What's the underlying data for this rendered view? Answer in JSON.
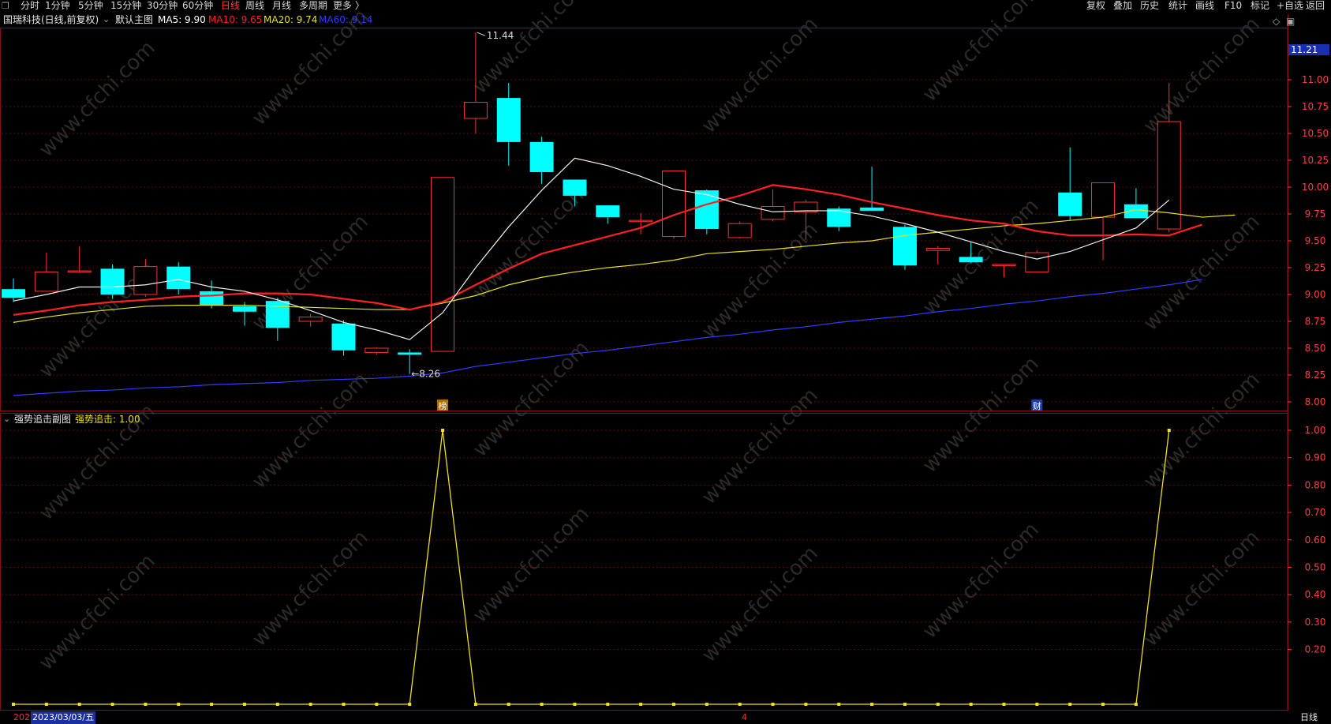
{
  "toolbar": {
    "corner_icon": "window-restore-icon",
    "left_items": [
      "分时",
      "1分钟",
      "5分钟",
      "15分钟",
      "30分钟",
      "60分钟",
      "日线",
      "周线",
      "月线",
      "多周期",
      "更多 〉"
    ],
    "active_item": "日线",
    "right_items": [
      "复权",
      "叠加",
      "历史",
      "统计",
      "画线",
      "F10",
      "标记",
      "+自选",
      "返回"
    ]
  },
  "main_panel": {
    "stock_title": "国瑞科技(日线,前复权)",
    "template_label": "默认主图",
    "ma_items": [
      {
        "label": "MA5: 9.90",
        "color": "#ffffff"
      },
      {
        "label": "MA10: 9.65",
        "color": "#ff2020"
      },
      {
        "label": "MA20: 9.74",
        "color": "#e8e020"
      },
      {
        "label": "MA60: 9.14",
        "color": "#2f3cff"
      }
    ],
    "current_price_tag": "11.21",
    "high_label": "11.44",
    "low_label": "8.26",
    "event_marks": [
      "榜",
      "财"
    ],
    "y_ticks": [
      "11.00",
      "10.75",
      "10.50",
      "10.25",
      "10.00",
      "9.75",
      "9.50",
      "9.25",
      "9.00",
      "8.75",
      "8.50",
      "8.25",
      "8.00"
    ],
    "colors": {
      "up": "#ff3030",
      "down": "#00ffff",
      "grid": "#5a1010",
      "border": "#8b0f0f",
      "axis_text": "#ff4040"
    }
  },
  "sub_panel": {
    "title": "强势追击副图",
    "value_label": "强势追击: 1.00",
    "y_ticks": [
      "1.00",
      "0.90",
      "0.80",
      "0.70",
      "0.60",
      "0.50",
      "0.40",
      "0.30",
      "0.20"
    ]
  },
  "watermark": "www.cfchi.com",
  "bottom_bar": {
    "year_prefix": "202",
    "cursor_date": "2023/03/03/五",
    "mid_mark": "4",
    "period_label": "日线"
  },
  "chart_data": [
    {
      "type": "candlestick",
      "title": "",
      "series": [
        {
          "name": "K线",
          "ohlc": [
            [
              9.05,
              8.97,
              9.15,
              8.93
            ],
            [
              9.03,
              9.21,
              9.39,
              9.03
            ],
            [
              9.21,
              9.22,
              9.45,
              9.2
            ],
            [
              9.24,
              9.0,
              9.28,
              8.96
            ],
            [
              9.0,
              9.26,
              9.33,
              8.98
            ],
            [
              9.26,
              9.05,
              9.3,
              9.0
            ],
            [
              9.03,
              8.9,
              9.13,
              8.87
            ],
            [
              8.89,
              8.84,
              8.93,
              8.71
            ],
            [
              8.94,
              8.69,
              8.97,
              8.57
            ],
            [
              8.75,
              8.79,
              8.82,
              8.7
            ],
            [
              8.73,
              8.48,
              8.76,
              8.43
            ],
            [
              8.46,
              8.5,
              8.51,
              8.44
            ],
            [
              8.46,
              8.44,
              8.49,
              8.26
            ],
            [
              8.47,
              10.09,
              10.09,
              8.47
            ],
            [
              10.64,
              10.79,
              11.44,
              10.5
            ],
            [
              10.83,
              10.42,
              10.97,
              10.2
            ],
            [
              10.42,
              10.14,
              10.47,
              10.03
            ],
            [
              10.07,
              9.92,
              10.07,
              9.82
            ],
            [
              9.83,
              9.72,
              9.83,
              9.66
            ],
            [
              9.69,
              9.69,
              9.76,
              9.56
            ],
            [
              9.54,
              10.15,
              10.15,
              9.52
            ],
            [
              9.97,
              9.61,
              9.98,
              9.56
            ],
            [
              9.53,
              9.66,
              9.68,
              9.52
            ],
            [
              9.7,
              9.82,
              9.98,
              9.68
            ],
            [
              9.77,
              9.86,
              9.88,
              9.51
            ],
            [
              9.8,
              9.63,
              9.82,
              9.59
            ],
            [
              9.81,
              9.78,
              10.19,
              9.78
            ],
            [
              9.63,
              9.27,
              9.65,
              9.23
            ],
            [
              9.41,
              9.43,
              9.45,
              9.28
            ],
            [
              9.35,
              9.3,
              9.49,
              9.29
            ],
            [
              9.28,
              9.28,
              9.28,
              9.16
            ],
            [
              9.21,
              9.39,
              9.41,
              9.21
            ],
            [
              9.95,
              9.73,
              10.37,
              9.69
            ],
            [
              9.72,
              10.04,
              10.04,
              9.32
            ],
            [
              9.84,
              9.71,
              9.99,
              9.71
            ],
            [
              9.61,
              10.61,
              10.97,
              9.58
            ]
          ]
        }
      ],
      "ma": {
        "MA5": [
          8.94,
          9.0,
          9.07,
          9.07,
          9.09,
          9.14,
          9.07,
          9.03,
          8.95,
          8.85,
          8.74,
          8.67,
          8.58,
          8.83,
          9.25,
          9.63,
          9.97,
          10.27,
          10.2,
          10.1,
          9.98,
          9.93,
          9.84,
          9.77,
          9.78,
          9.78,
          9.73,
          9.66,
          9.58,
          9.49,
          9.4,
          9.33,
          9.4,
          9.51,
          9.62,
          9.88
        ],
        "MA10": [
          8.81,
          8.85,
          8.9,
          8.93,
          8.95,
          8.98,
          8.99,
          9.01,
          9.01,
          9.0,
          8.96,
          8.92,
          8.86,
          8.93,
          9.09,
          9.24,
          9.38,
          9.46,
          9.54,
          9.62,
          9.74,
          9.84,
          9.92,
          10.02,
          9.98,
          9.93,
          9.86,
          9.8,
          9.74,
          9.69,
          9.66,
          9.59,
          9.55,
          9.55,
          9.56,
          9.55,
          9.65
        ],
        "MA20": [
          8.74,
          8.79,
          8.83,
          8.86,
          8.89,
          8.9,
          8.9,
          8.9,
          8.89,
          8.88,
          8.87,
          8.86,
          8.86,
          8.92,
          8.99,
          9.09,
          9.16,
          9.21,
          9.25,
          9.28,
          9.32,
          9.38,
          9.4,
          9.42,
          9.45,
          9.48,
          9.5,
          9.55,
          9.58,
          9.61,
          9.64,
          9.66,
          9.69,
          9.72,
          9.79,
          9.76,
          9.72,
          9.74
        ],
        "MA60": [
          8.06,
          8.08,
          8.1,
          8.11,
          8.13,
          8.14,
          8.16,
          8.17,
          8.18,
          8.2,
          8.21,
          8.22,
          8.24,
          8.27,
          8.33,
          8.37,
          8.41,
          8.45,
          8.48,
          8.52,
          8.56,
          8.6,
          8.63,
          8.67,
          8.7,
          8.74,
          8.77,
          8.8,
          8.84,
          8.87,
          8.91,
          8.94,
          8.98,
          9.01,
          9.05,
          9.09,
          9.14
        ]
      },
      "ylim": [
        8.0,
        11.21
      ]
    },
    {
      "type": "line",
      "title": "",
      "series": [
        {
          "name": "强势追击",
          "values": [
            0,
            0,
            0,
            0,
            0,
            0,
            0,
            0,
            0,
            0,
            0,
            0,
            0,
            1,
            0,
            0,
            0,
            0,
            0,
            0,
            0,
            0,
            0,
            0,
            0,
            0,
            0,
            0,
            0,
            0,
            0,
            0,
            0,
            0,
            0,
            1
          ]
        }
      ],
      "ylim": [
        0,
        1.0
      ]
    }
  ]
}
